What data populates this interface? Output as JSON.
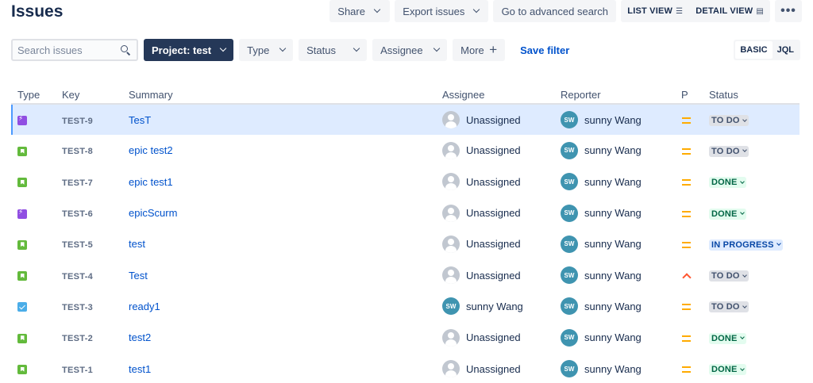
{
  "page_title": "Issues",
  "toolbar": {
    "share": "Share",
    "export": "Export issues",
    "advanced_search": "Go to advanced search",
    "list_view": "LIST VIEW",
    "detail_view": "DETAIL VIEW",
    "more": "•••"
  },
  "filters": {
    "search_placeholder": "Search issues",
    "project": "Project: test",
    "type": "Type",
    "status": "Status",
    "assignee": "Assignee",
    "more": "More",
    "save_filter": "Save filter",
    "mode_basic": "BASIC",
    "mode_jql": "JQL"
  },
  "columns": {
    "type": "Type",
    "key": "Key",
    "summary": "Summary",
    "assignee": "Assignee",
    "reporter": "Reporter",
    "priority": "P",
    "status": "Status"
  },
  "issues": [
    {
      "type": "epic",
      "key": "TEST-9",
      "summary": "TesT",
      "assignee": "Unassigned",
      "assignee_initials": "",
      "reporter": "sunny Wang",
      "reporter_initials": "SW",
      "priority": "medium",
      "status": "TO DO",
      "status_kind": "todo",
      "selected": true
    },
    {
      "type": "story",
      "key": "TEST-8",
      "summary": "epic test2",
      "assignee": "Unassigned",
      "assignee_initials": "",
      "reporter": "sunny Wang",
      "reporter_initials": "SW",
      "priority": "medium",
      "status": "TO DO",
      "status_kind": "todo",
      "selected": false
    },
    {
      "type": "story",
      "key": "TEST-7",
      "summary": "epic test1",
      "assignee": "Unassigned",
      "assignee_initials": "",
      "reporter": "sunny Wang",
      "reporter_initials": "SW",
      "priority": "medium",
      "status": "DONE",
      "status_kind": "done",
      "selected": false
    },
    {
      "type": "epic",
      "key": "TEST-6",
      "summary": "epicScurm",
      "assignee": "Unassigned",
      "assignee_initials": "",
      "reporter": "sunny Wang",
      "reporter_initials": "SW",
      "priority": "medium",
      "status": "DONE",
      "status_kind": "done",
      "selected": false
    },
    {
      "type": "story",
      "key": "TEST-5",
      "summary": "test",
      "assignee": "Unassigned",
      "assignee_initials": "",
      "reporter": "sunny Wang",
      "reporter_initials": "SW",
      "priority": "medium",
      "status": "IN PROGRESS",
      "status_kind": "inprogress",
      "selected": false
    },
    {
      "type": "story",
      "key": "TEST-4",
      "summary": "Test",
      "assignee": "Unassigned",
      "assignee_initials": "",
      "reporter": "sunny Wang",
      "reporter_initials": "SW",
      "priority": "high",
      "status": "TO DO",
      "status_kind": "todo",
      "selected": false
    },
    {
      "type": "task",
      "key": "TEST-3",
      "summary": "ready1",
      "assignee": "sunny Wang",
      "assignee_initials": "SW",
      "reporter": "sunny Wang",
      "reporter_initials": "SW",
      "priority": "medium",
      "status": "TO DO",
      "status_kind": "todo",
      "selected": false
    },
    {
      "type": "story",
      "key": "TEST-2",
      "summary": "test2",
      "assignee": "Unassigned",
      "assignee_initials": "",
      "reporter": "sunny Wang",
      "reporter_initials": "SW",
      "priority": "medium",
      "status": "DONE",
      "status_kind": "done",
      "selected": false
    },
    {
      "type": "story",
      "key": "TEST-1",
      "summary": "test1",
      "assignee": "Unassigned",
      "assignee_initials": "",
      "reporter": "sunny Wang",
      "reporter_initials": "SW",
      "priority": "medium",
      "status": "DONE",
      "status_kind": "done",
      "selected": false
    }
  ],
  "colors": {
    "accent": "#0052cc",
    "project_button": "#253858",
    "selected_row": "#deebff",
    "epic": "#904ee2",
    "story": "#63ba3c",
    "task": "#4bade8",
    "priority_medium": "#ffab00",
    "priority_high": "#ff5630"
  }
}
